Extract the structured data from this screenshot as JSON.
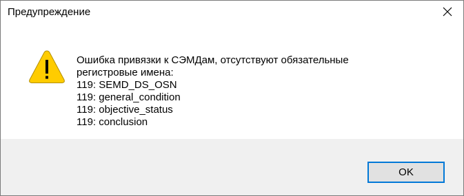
{
  "window": {
    "title": "Предупреждение",
    "close_icon": "close-icon"
  },
  "message": {
    "icon": "warning-icon",
    "lines": [
      "Ошибка привязки к СЭМДам, отсутствуют обязательные",
      "регистровые имена:",
      "119: SEMD_DS_OSN",
      "119: general_condition",
      "119: objective_status",
      "119: conclusion"
    ]
  },
  "buttons": {
    "ok_label": "OK"
  },
  "colors": {
    "accent": "#0078d7",
    "warning": "#ffcc00",
    "footer_bg": "#f0f0f0"
  }
}
